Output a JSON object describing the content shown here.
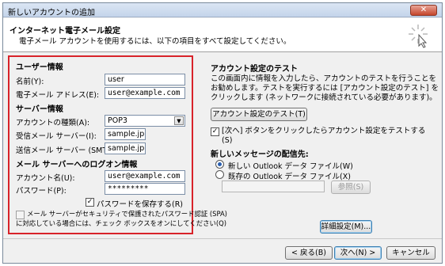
{
  "window": {
    "title": "新しいアカウントの追加",
    "close_label": "✕"
  },
  "header": {
    "title": "インターネット電子メール設定",
    "subtitle": "電子メール アカウントを使用するには、以下の項目をすべて設定してください。"
  },
  "user_info": {
    "section": "ユーザー情報",
    "name_label": "名前(Y):",
    "name_value": "user",
    "email_label": "電子メール アドレス(E):",
    "email_value": "user@example.com"
  },
  "server_info": {
    "section": "サーバー情報",
    "account_type_label": "アカウントの種類(A):",
    "account_type_value": "POP3",
    "incoming_label": "受信メール サーバー(I):",
    "incoming_value": "sample.jp",
    "outgoing_label": "送信メール サーバー (SMTP)(O):",
    "outgoing_value": "sample.jp"
  },
  "logon_info": {
    "section": "メール サーバーへのログオン情報",
    "account_label": "アカウント名(U):",
    "account_value": "user@example.com",
    "password_label": "パスワード(P):",
    "password_value": "*********",
    "remember_label": "パスワードを保存する(R)",
    "remember_checked": true,
    "spa_label_1": "メール サーバーがセキュリティで保護されたパスワード認証 (SPA)",
    "spa_label_2": "に対応している場合には、チェック ボックスをオンにしてください(Q)",
    "spa_checked": false
  },
  "test": {
    "section": "アカウント設定のテスト",
    "desc_1": "この画面内に情報を入力したら、アカウントのテストを行うことを",
    "desc_2": "お勧めします。テストを実行するには [アカウント設定のテスト] を",
    "desc_3": "クリックします (ネットワークに接続されている必要があります)。",
    "test_button": "アカウント設定のテスト(T)",
    "auto_test_1": "[次へ] ボタンをクリックしたらアカウント設定をテストする",
    "auto_test_2": "(S)",
    "auto_test_checked": true
  },
  "delivery": {
    "section": "新しいメッセージの配信先:",
    "option_new": "新しい Outlook データ ファイル(W)",
    "option_existing": "既存の Outlook データ ファイル(X)",
    "selected": "new",
    "browse_button": "参照(S)"
  },
  "advanced_button": "詳細設定(M)...",
  "footer": {
    "back": "< 戻る(B)",
    "next": "次へ(N) >",
    "cancel": "キャンセル"
  },
  "icons": {
    "check": "✓",
    "dropdown": "▼"
  },
  "colors": {
    "highlight_box": "#d8232a"
  }
}
